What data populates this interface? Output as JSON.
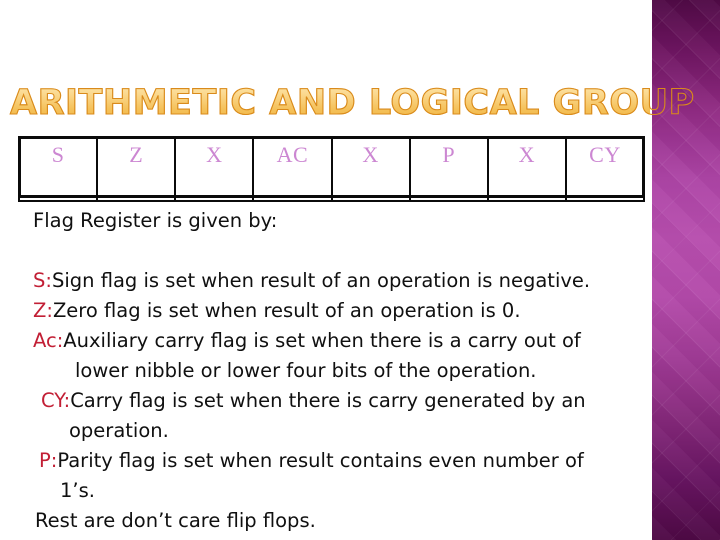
{
  "slide": {
    "title": "ARITHMETIC AND LOGICAL GROUP",
    "title_colors": {
      "fill_light": "#fde9b6",
      "fill_dark": "#edb03b",
      "outline": "#d98a1b"
    },
    "background_color": "#ffffff",
    "accent_band": {
      "top_color": "#500b46",
      "mid_color": "#b74eae",
      "bottom_color": "#4e0a45"
    }
  },
  "flag_register_table": {
    "cells": [
      {
        "label": "S"
      },
      {
        "label": "Z"
      },
      {
        "label": "X"
      },
      {
        "label": "AC"
      },
      {
        "label": "X"
      },
      {
        "label": "P"
      },
      {
        "label": "X"
      },
      {
        "label": "CY"
      }
    ],
    "text_color": "#cc87d2",
    "border_color": "#0b0b0b"
  },
  "body": {
    "intro": "Flag Register is given by:",
    "prefix_color": "#c21f35",
    "lines": [
      {
        "prefix": "S",
        "sep": ":",
        "text": "Sign flag is set when result of an operation is negative."
      },
      {
        "prefix": "Z",
        "sep": ":",
        "text": "Zero flag is set when result of an operation is 0."
      },
      {
        "prefix": "Ac",
        "sep": ":",
        "text": "Auxiliary carry flag is set when there is a carry out of"
      },
      {
        "cont": "lower nibble or lower four bits of the operation."
      },
      {
        "prefix": "CY",
        "sep": ":",
        "text": "Carry flag is set when there is carry generated by an"
      },
      {
        "cont": "operation."
      },
      {
        "prefix": "P",
        "sep": ":",
        "text": "Parity flag is set when result contains even number of"
      },
      {
        "cont": "1’s."
      },
      {
        "plain": "Rest are don’t care flip flops."
      }
    ]
  }
}
